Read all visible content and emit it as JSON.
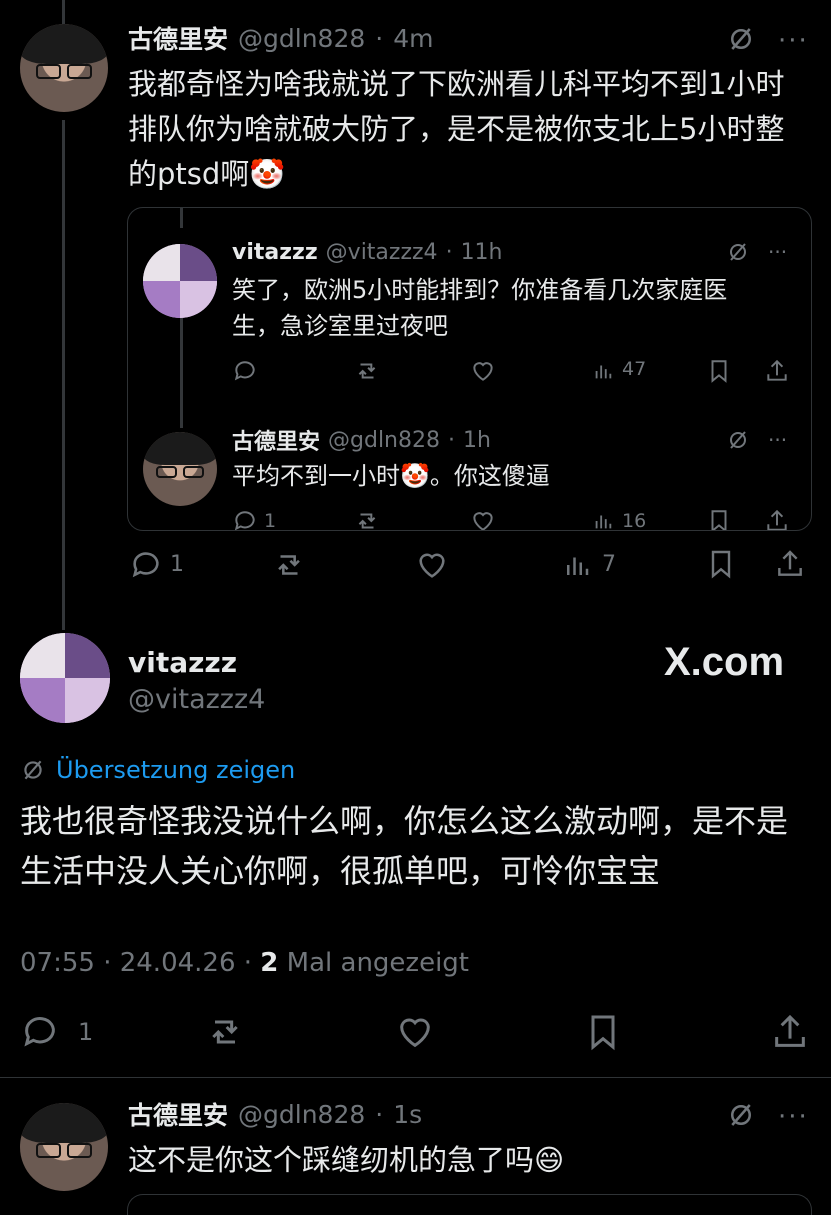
{
  "post1": {
    "name": "古德里安",
    "handle": "@gdln828",
    "time": "4m",
    "text": "我都奇怪为啥我就说了下欧洲看儿科平均不到1小时排队你为啥就破大防了，是不是被你支北上5小时整的ptsd啊🤡",
    "stats": {
      "replies": "1",
      "views": "7"
    }
  },
  "quote": {
    "post_a": {
      "name": "vitazzz",
      "handle": "@vitazzz4",
      "time": "11h",
      "text": "笑了，欧洲5小时能排到？你准备看几次家庭医生，急诊室里过夜吧",
      "stats": {
        "views": "47"
      }
    },
    "post_b": {
      "name": "古德里安",
      "handle": "@gdln828",
      "time": "1h",
      "text": "平均不到一小时🤡。你这傻逼",
      "stats": {
        "replies": "1",
        "views": "16"
      }
    }
  },
  "main": {
    "name": "vitazzz",
    "handle": "@vitazzz4",
    "watermark": "X.com",
    "translate_label": "Übersetzung zeigen",
    "text": "我也很奇怪我没说什么啊，你怎么这么激动啊，是不是生活中没人关心你啊，很孤单吧，可怜你宝宝",
    "meta_time": "07:55 · 24.04.26 · ",
    "meta_count": "2",
    "meta_suffix": " Mal angezeigt",
    "stats": {
      "replies": "1"
    }
  },
  "post3": {
    "name": "古德里安",
    "handle": "@gdln828",
    "time": "1s",
    "text": "这不是你这个踩缝纫机的急了吗😄"
  },
  "icons": [
    "reply-icon",
    "repost-icon",
    "like-icon",
    "views-icon",
    "bookmark-icon",
    "share-icon",
    "grok-icon",
    "more-icon",
    "translate-icon"
  ]
}
